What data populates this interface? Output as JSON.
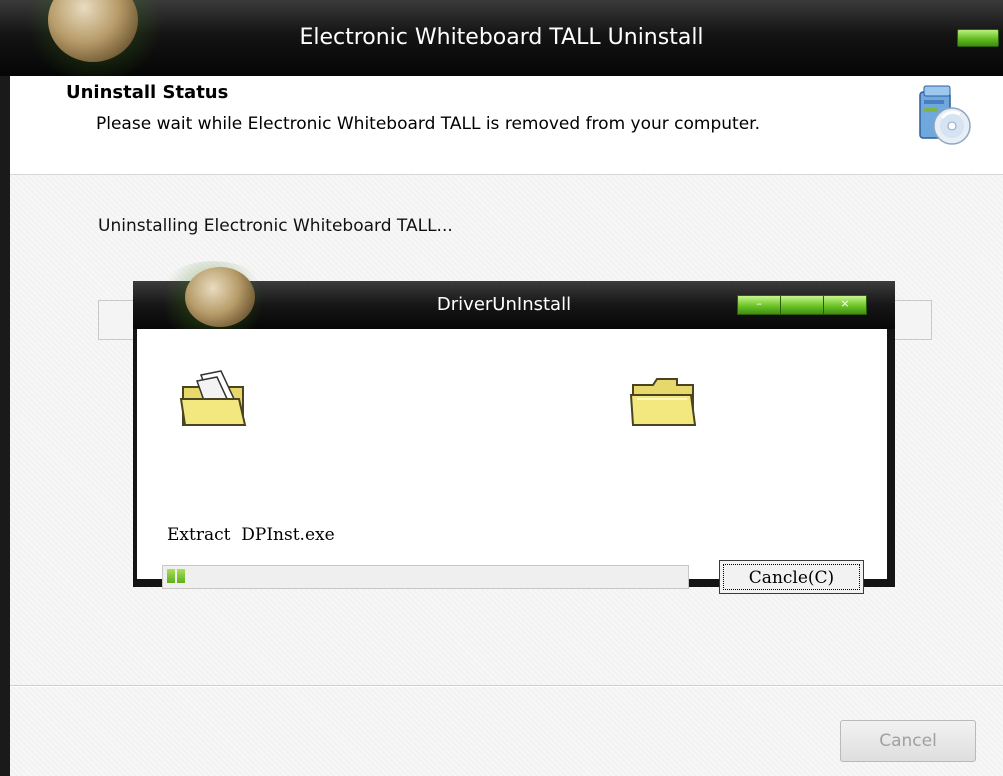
{
  "window": {
    "title": "Electronic Whiteboard TALL Uninstall",
    "header_title": "Uninstall Status",
    "header_subtitle": "Please wait while Electronic Whiteboard TALL is removed from your computer.",
    "status_text": "Uninstalling Electronic Whiteboard TALL...",
    "cancel_label": "Cancel",
    "cancel_enabled": false
  },
  "dialog": {
    "title": "DriverUnInstall",
    "minimize_label": "–",
    "close_label": "×",
    "action": "Extract",
    "filename": "DPInst.exe",
    "cancel_label": "Cancle(C)",
    "progress_percent": 4
  },
  "icons": {
    "app_logo": "soccer-ball-icon",
    "installer": "install-disc-icon",
    "source_folder": "open-folder-icon",
    "target_folder": "closed-folder-icon"
  },
  "colors": {
    "title_bar": "#0c0c0c",
    "window_button_green": "#5fb81e",
    "progress_green": "#6cc426",
    "body_background": "#f7f7f7"
  }
}
